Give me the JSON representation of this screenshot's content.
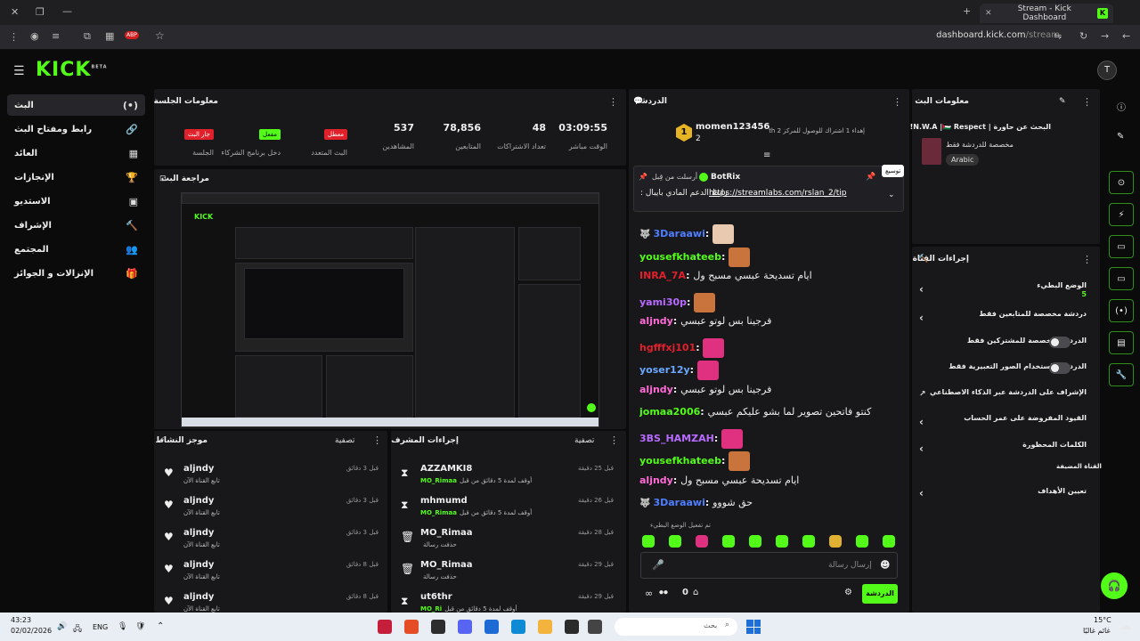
{
  "browser": {
    "tab_title": "Stream - Kick Dashboard",
    "url_domain": "dashboard.kick.com",
    "url_path": "/stream",
    "ext_badge": "ABP"
  },
  "app": {
    "logo": "KICK",
    "logo_beta": "BETA",
    "avatar_initial": "T"
  },
  "nav": [
    {
      "label": "البث",
      "icon": "(•)"
    },
    {
      "label": "رابط ومفتاح البث",
      "icon": "🔗"
    },
    {
      "label": "العائد",
      "icon": "▦"
    },
    {
      "label": "الإنجازات",
      "icon": "🏆"
    },
    {
      "label": "الاستديو",
      "icon": "▣"
    },
    {
      "label": "الإشراف",
      "icon": "🔨"
    },
    {
      "label": "المجتمع",
      "icon": "👥"
    },
    {
      "label": "الإنزالات و الجوائز",
      "icon": "🎁"
    }
  ],
  "session": {
    "title": "معلومات الجلسة",
    "stats": [
      {
        "value": "03:09:55",
        "label": "الوقت مباشر"
      },
      {
        "value": "48",
        "label": "تعداد الاشتراكات"
      },
      {
        "value": "78,856",
        "label": "المتابعين"
      },
      {
        "value": "537",
        "label": "المشاهدين"
      }
    ],
    "badges": [
      {
        "text": "معطل",
        "label": "البث المتعدد",
        "color": "#e0202a"
      },
      {
        "text": "مفعل",
        "label": "دخل برنامج الشركاء",
        "color": "#53fc18"
      },
      {
        "text": "جار البث",
        "label": "الجلسة",
        "color": "#e0202a"
      }
    ]
  },
  "preview": {
    "title": "مراجعة البث"
  },
  "activity": {
    "title": "موجز النشاط",
    "filter": "تصفية",
    "items": [
      {
        "name": "aljndy",
        "sub": "تابع القناة الآن",
        "time": "قبل 3 دقائق"
      },
      {
        "name": "aljndy",
        "sub": "تابع القناة الآن",
        "time": "قبل 3 دقائق"
      },
      {
        "name": "aljndy",
        "sub": "تابع القناة الآن",
        "time": "قبل 3 دقائق"
      },
      {
        "name": "aljndy",
        "sub": "تابع القناة الآن",
        "time": "قبل 8 دقائق"
      },
      {
        "name": "aljndy",
        "sub": "تابع القناة الآن",
        "time": "قبل 8 دقائق"
      }
    ]
  },
  "modactions": {
    "title": "إجراءات المشرف",
    "filter": "تصفية",
    "items": [
      {
        "name": "AZZAMKI8",
        "sub": "أوقف لمدة 5 دقائق من قبل",
        "by": "MO_Rimaa",
        "time": "قبل 25 دقيقة",
        "icon": "⧗"
      },
      {
        "name": "mhmumd",
        "sub": "أوقف لمدة 5 دقائق من قبل",
        "by": "MO_Rimaa",
        "time": "قبل 26 دقيقة",
        "icon": "⧗"
      },
      {
        "name": "MO_Rimaa",
        "sub": "حذفت رسالة",
        "by": "",
        "time": "قبل 28 دقيقة",
        "icon": "🗑"
      },
      {
        "name": "MO_Rimaa",
        "sub": "حذفت رسالة",
        "by": "",
        "time": "قبل 29 دقيقة",
        "icon": "🗑"
      },
      {
        "name": "ut6thr",
        "sub": "أوقف لمدة 5 دقائق من قبل",
        "by": "MO_Ri",
        "time": "قبل 29 دقيقة",
        "icon": "⧗"
      }
    ]
  },
  "chat": {
    "title": "الدردشة",
    "leader": {
      "name": "momen123456",
      "rank": "1",
      "count": "2",
      "goal": "إهداء 1 اشتراك للوصول للمركز 2 th"
    },
    "pinned": {
      "by": "BotRix",
      "label": "أرسلت من قِبل",
      "text_prefix": "رابط الدعم المادي بايبال :",
      "link": "https://streamlabs.com/rslan_2/tip",
      "tooltip": "توسيع"
    },
    "messages": [
      {
        "user": "3Daraawi",
        "color": "#4f7fff",
        "text": "",
        "emote": "#e9c9b0"
      },
      {
        "user": "yousefkhateeb",
        "color": "#53fc18",
        "text": "",
        "emote": "#c8743c"
      },
      {
        "user": "INRA_7A",
        "color": "#e0202a",
        "text": "ايام تسديحة عبسي مسبح ول",
        "emote": ""
      },
      {
        "user": "yami30p",
        "color": "#b86bff",
        "text": "",
        "emote": "#c8743c"
      },
      {
        "user": "aljndy",
        "color": "#ff6bd6",
        "text": "فرجينا بس لوتو عبسي",
        "emote": ""
      },
      {
        "user": "hgfffxj101",
        "color": "#e0202a",
        "text": "",
        "emote": "#e03080"
      },
      {
        "user": "yoser12y",
        "color": "#6aa8ff",
        "text": "",
        "emote": "#e03080"
      },
      {
        "user": "aljndy",
        "color": "#ff6bd6",
        "text": "فرجينا بس لوتو عبسي",
        "emote": ""
      },
      {
        "user": "jomaa2006",
        "color": "#53fc18",
        "text": "كنتو فاتحين تصوير لما بشو عليكم عبسي",
        "emote": ""
      },
      {
        "user": "3BS_HAMZAH",
        "color": "#b86bff",
        "text": "",
        "emote": "#e03080"
      },
      {
        "user": "yousefkhateeb",
        "color": "#53fc18",
        "text": "",
        "emote": "#c8743c"
      },
      {
        "user": "aljndy",
        "color": "#ff6bd6",
        "text": "ايام تسديحة عبسي مسبح ول",
        "emote": ""
      },
      {
        "user": "3Daraawi",
        "color": "#4f7fff",
        "text": "حق شووو",
        "emote": ""
      }
    ],
    "emoji_mode": "تم تفعيل الوضع البطيء",
    "input_placeholder": "إرسال رسالة",
    "send_label": "الدردشة",
    "count": "0"
  },
  "about": {
    "title": "معلومات البث",
    "stream_title": "البحث عن حاورة | N.W.A |🇵🇸 Respect!",
    "category": "مخصصة للدردشة فقط",
    "language": "Arabic"
  },
  "channel": {
    "title": "إجراءات القناة",
    "rows": [
      {
        "label": "الوضع البطيء",
        "sub": "5",
        "type": "arrow"
      },
      {
        "label": "دردشة مخصصة للمتابعين فقط",
        "type": "arrow"
      },
      {
        "label": "الدردشة مخصصة للمشتركين فقط",
        "type": "toggle"
      },
      {
        "label": "الدردشة باستخدام الصور التعبيرية فقط",
        "type": "toggle"
      },
      {
        "label": "الإشراف على الدردشة عبر الذكاء الاصطناعي",
        "type": "ext"
      },
      {
        "label": "القيود المفروضة على عمر الحساب",
        "type": "arrow"
      },
      {
        "label": "الكلمات المحظورة",
        "type": "arrow"
      }
    ],
    "section2": "القناة المضيفة",
    "target": "تعيين الأهداف"
  },
  "taskbar": {
    "time": "43:23",
    "date": "02/02/2026",
    "lang": "ENG",
    "search": "بحث",
    "weather_temp": "15°C",
    "weather_text": "غائم غالبًا"
  }
}
